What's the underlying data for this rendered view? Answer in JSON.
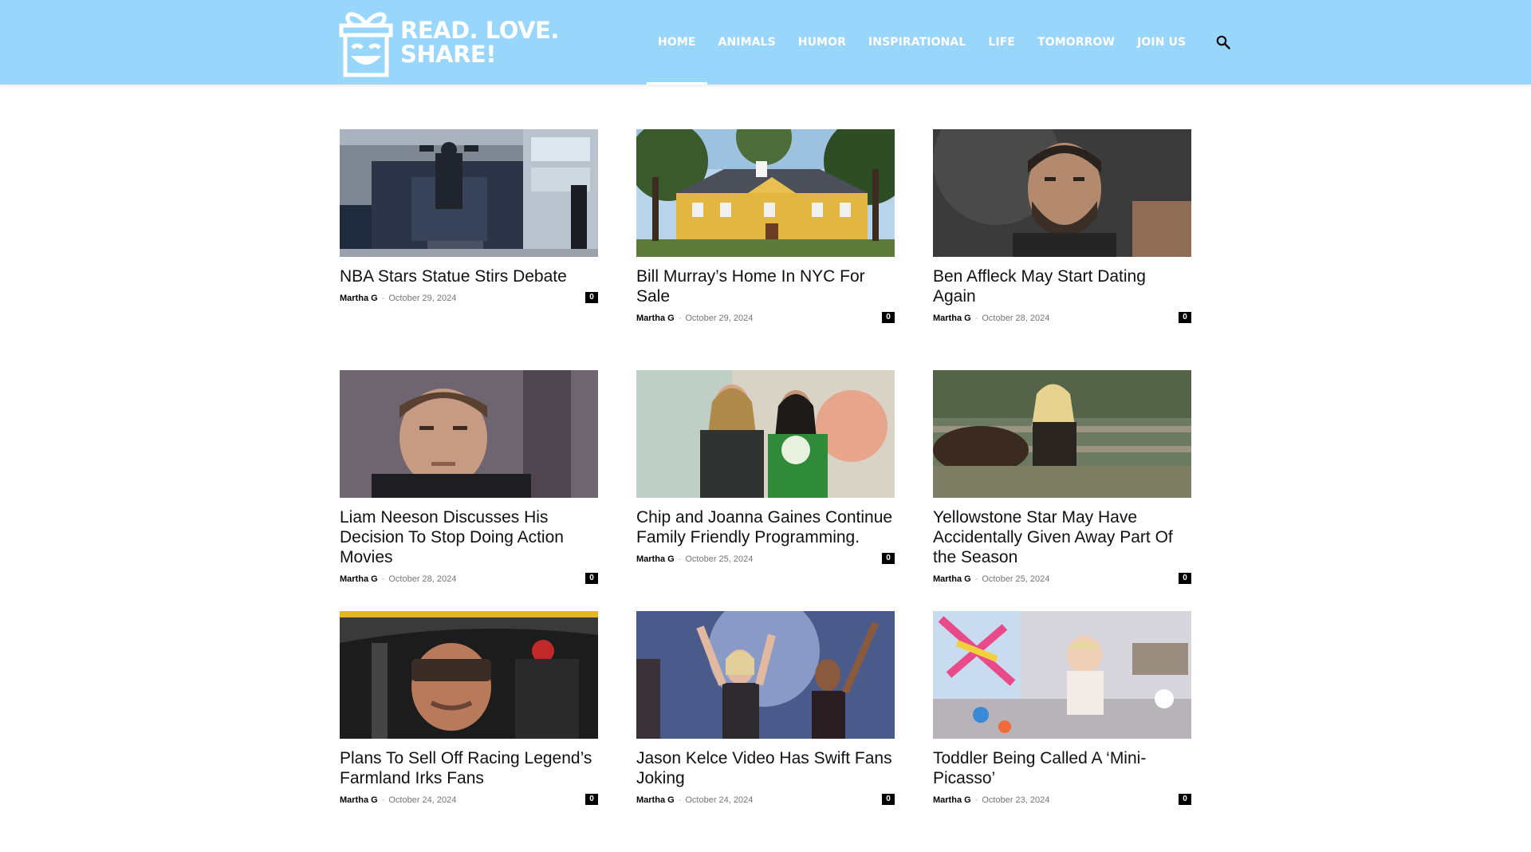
{
  "site": {
    "logo_line1": "READ. LOVE.",
    "logo_line2": "SHARE!",
    "logo_icon": "gift-smile-icon"
  },
  "nav": {
    "items": [
      {
        "label": "HOME",
        "active": true
      },
      {
        "label": "ANIMALS"
      },
      {
        "label": "HUMOR"
      },
      {
        "label": "INSPIRATIONAL"
      },
      {
        "label": "LIFE"
      },
      {
        "label": "TOMORROW"
      },
      {
        "label": "JOIN US"
      }
    ],
    "search_icon": "search-icon"
  },
  "colors": {
    "header_bg": "#99d6fb",
    "text": "#111111",
    "date": "#767676",
    "badge_bg": "#000000"
  },
  "posts": [
    {
      "title": "NBA Stars Statue Stirs Debate",
      "author": "Martha G",
      "date": "October 29, 2024",
      "comments": "0"
    },
    {
      "title": "Bill Murray’s Home In NYC For Sale",
      "author": "Martha G",
      "date": "October 29, 2024",
      "comments": "0"
    },
    {
      "title": "Ben Affleck May Start Dating Again",
      "author": "Martha G",
      "date": "October 28, 2024",
      "comments": "0"
    },
    {
      "title": "Liam Neeson Discusses His Decision To Stop Doing Action Movies",
      "author": "Martha G",
      "date": "October 28, 2024",
      "comments": "0"
    },
    {
      "title": "Chip and Joanna Gaines Continue Family Friendly Programming.",
      "author": "Martha G",
      "date": "October 25, 2024",
      "comments": "0"
    },
    {
      "title": "Yellowstone Star May Have Accidentally Given Away Part Of the Season",
      "author": "Martha G",
      "date": "October 25, 2024",
      "comments": "0"
    },
    {
      "title": "Plans To Sell Off Racing Legend’s Farmland Irks Fans",
      "author": "Martha G",
      "date": "October 24, 2024",
      "comments": "0"
    },
    {
      "title": "Jason Kelce Video Has Swift Fans Joking",
      "author": "Martha G",
      "date": "October 24, 2024",
      "comments": "0"
    },
    {
      "title": "Toddler Being Called A ‘Mini-Picasso’",
      "author": "Martha G",
      "date": "October 23, 2024",
      "comments": "0"
    }
  ]
}
